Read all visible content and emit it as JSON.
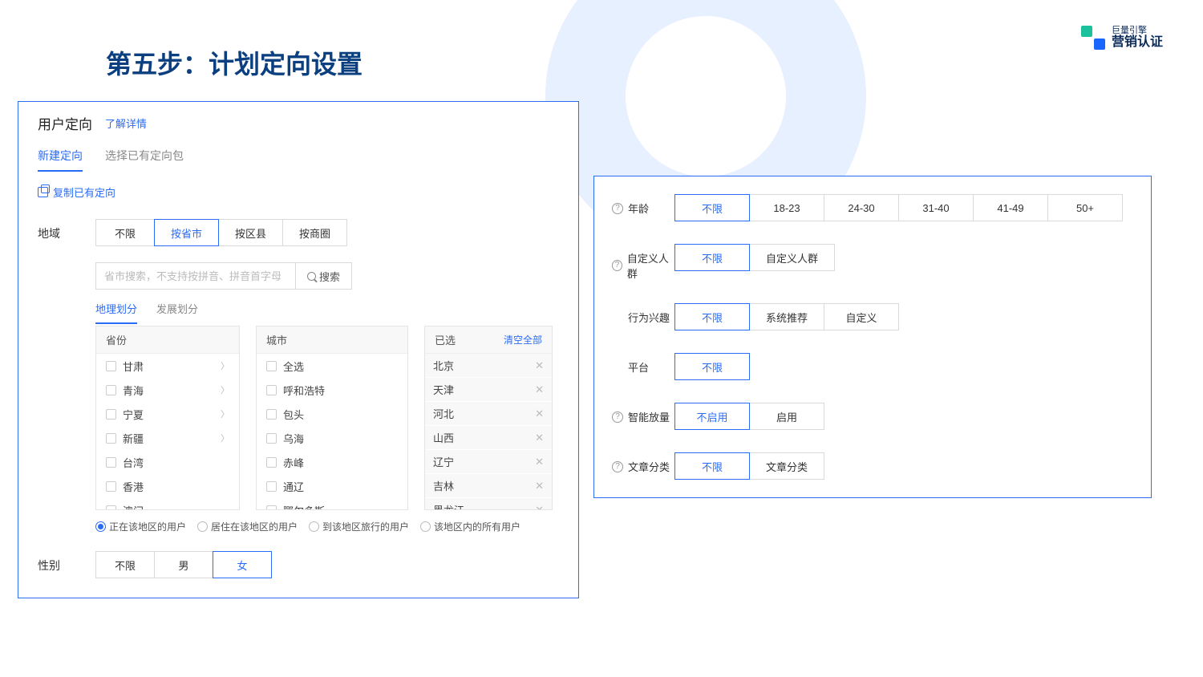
{
  "page_title": "第五步：计划定向设置",
  "logo": {
    "line1": "巨量引擎",
    "line2": "营销认证"
  },
  "left": {
    "title": "用户定向",
    "detail_link": "了解详情",
    "tabs": {
      "new": "新建定向",
      "existing": "选择已有定向包"
    },
    "copy_link": "复制已有定向",
    "region": {
      "label": "地域",
      "options": [
        "不限",
        "按省市",
        "按区县",
        "按商圈"
      ],
      "search_placeholder": "省市搜索，不支持按拼音、拼音首字母",
      "search_btn": "搜索",
      "inner_tabs": {
        "geo": "地理划分",
        "dev": "发展划分"
      },
      "provinces_head": "省份",
      "cities_head": "城市",
      "selected_head": "已选",
      "clear_all": "清空全部",
      "provinces": [
        {
          "name": "甘肃",
          "chev": true
        },
        {
          "name": "青海",
          "chev": true
        },
        {
          "name": "宁夏",
          "chev": true
        },
        {
          "name": "新疆",
          "chev": true
        },
        {
          "name": "台湾",
          "chev": false
        },
        {
          "name": "香港",
          "chev": false
        },
        {
          "name": "澳门",
          "chev": false
        }
      ],
      "cities": [
        "全选",
        "呼和浩特",
        "包头",
        "乌海",
        "赤峰",
        "通辽",
        "鄂尔多斯"
      ],
      "selected": [
        "北京",
        "天津",
        "河北",
        "山西",
        "辽宁",
        "吉林",
        "黑龙江"
      ],
      "radios": [
        "正在该地区的用户",
        "居住在该地区的用户",
        "到该地区旅行的用户",
        "该地区内的所有用户"
      ]
    },
    "gender": {
      "label": "性别",
      "options": [
        "不限",
        "男",
        "女"
      ]
    }
  },
  "right": {
    "age": {
      "label": "年龄",
      "options": [
        "不限",
        "18-23",
        "24-30",
        "31-40",
        "41-49",
        "50+"
      ]
    },
    "custom_people": {
      "label": "自定义人群",
      "options": [
        "不限",
        "自定义人群"
      ]
    },
    "interest": {
      "label": "行为兴趣",
      "options": [
        "不限",
        "系统推荐",
        "自定义"
      ]
    },
    "platform": {
      "label": "平台",
      "options": [
        "不限"
      ]
    },
    "smart": {
      "label": "智能放量",
      "options": [
        "不启用",
        "启用"
      ]
    },
    "article": {
      "label": "文章分类",
      "options": [
        "不限",
        "文章分类"
      ]
    }
  }
}
